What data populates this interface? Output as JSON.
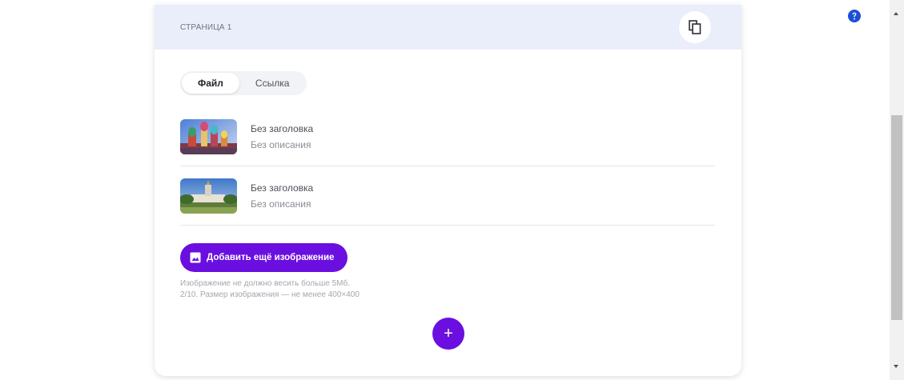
{
  "header": {
    "title": "СТРАНИЦА 1",
    "copy_icon": "copy-icon"
  },
  "tabs": [
    {
      "label": "Файл",
      "active": true
    },
    {
      "label": "Ссылка",
      "active": false
    }
  ],
  "images": [
    {
      "title": "Без заголовка",
      "description": "Без описания",
      "thumb": "cathedral-thumbnail"
    },
    {
      "title": "Без заголовка",
      "description": "Без описания",
      "thumb": "park-building-thumbnail"
    }
  ],
  "add_button": {
    "label": "Добавить ещё изображение",
    "icon": "image-icon"
  },
  "hints": {
    "size": "Изображение не должно весить больше 5Мб.",
    "count": "2/10. Размер изображения — не менее 400×400"
  },
  "plus_button": {
    "label": "+"
  },
  "help_button": {
    "icon": "help-icon"
  },
  "colors": {
    "accent": "#6a0fe0",
    "header_bg": "#eaeefa",
    "help": "#1a4fd6"
  }
}
